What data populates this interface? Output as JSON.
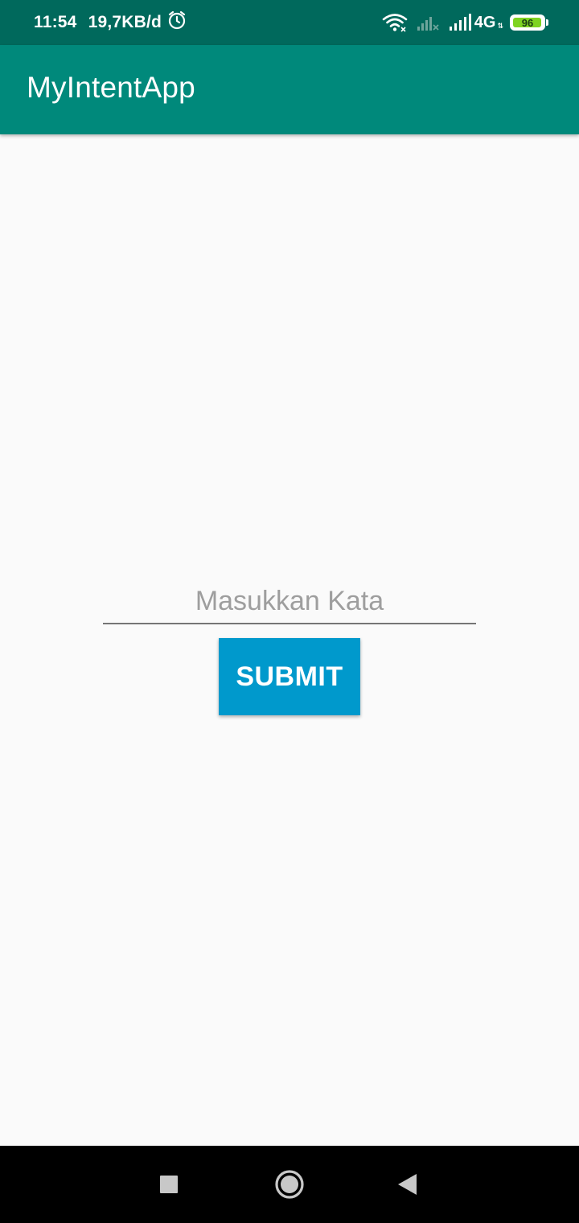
{
  "status_bar": {
    "time": "11:54",
    "data_speed": "19,7KB/d",
    "network_type": "4G",
    "network_sub": "⇅",
    "battery_level": "96",
    "battery_fraction": 0.96,
    "icons": [
      "alarm-icon",
      "wifi-icon",
      "signal-sim1-icon",
      "signal-sim2-icon",
      "battery-icon"
    ],
    "colors": {
      "background": "#00695c",
      "battery_fill": "#7ed321"
    }
  },
  "app_bar": {
    "title": "MyIntentApp",
    "color": "#00897b"
  },
  "form": {
    "input_value": "",
    "input_placeholder": "Masukkan Kata",
    "submit_label": "SUBMIT",
    "submit_color": "#0099cc"
  },
  "nav_bar": {
    "buttons": [
      "recents-icon",
      "home-icon",
      "back-icon"
    ]
  }
}
